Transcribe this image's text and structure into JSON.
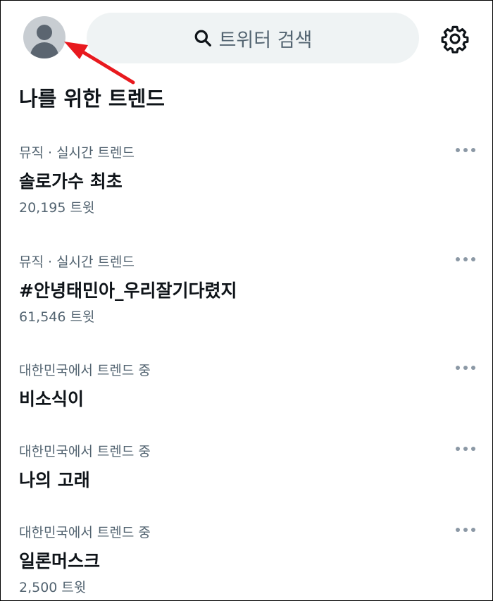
{
  "header": {
    "search_placeholder": "트위터 검색"
  },
  "section": {
    "title": "나를 위한 트렌드"
  },
  "trends": [
    {
      "meta": "뮤직 · 실시간 트렌드",
      "name": "솔로가수 최초",
      "count": "20,195 트윗"
    },
    {
      "meta": "뮤직 · 실시간 트렌드",
      "name": "#안녕태민아_우리잘기다렸지",
      "count": "61,546 트윗"
    },
    {
      "meta": "대한민국에서 트렌드 중",
      "name": "비소식이",
      "count": ""
    },
    {
      "meta": "대한민국에서 트렌드 중",
      "name": "나의 고래",
      "count": ""
    },
    {
      "meta": "대한민국에서 트렌드 중",
      "name": "일론머스크",
      "count": "2,500 트윗"
    }
  ],
  "icons": {
    "avatar": "avatar-placeholder",
    "search": "search-icon",
    "settings": "gear-icon",
    "more": "more-horizontal-icon",
    "annotation": "red-arrow"
  },
  "colors": {
    "secondary_text": "#536471",
    "search_bg": "#eff3f4",
    "annotation_arrow": "#e8191e"
  }
}
